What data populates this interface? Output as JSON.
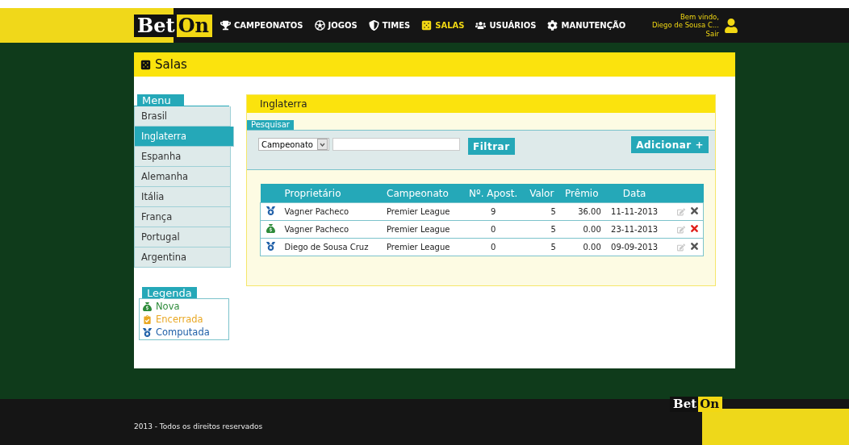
{
  "header": {
    "logo": {
      "part_1": "Bet",
      "part_2": "On"
    },
    "nav": [
      {
        "label": "CAMPEONATOS",
        "kind": "trophy",
        "selected": false
      },
      {
        "label": "JOGOS",
        "kind": "ball",
        "selected": false
      },
      {
        "label": "TIMES",
        "kind": "shield",
        "selected": false
      },
      {
        "label": "SALAS",
        "kind": "dice",
        "selected": true
      },
      {
        "label": "USUÁRIOS",
        "kind": "users",
        "selected": false
      },
      {
        "label": "MANUTENÇÃO",
        "kind": "gear",
        "selected": false
      }
    ],
    "user": {
      "greeting": "Bem vindo,",
      "name": "Diego de Sousa C...",
      "logout": "Sair"
    }
  },
  "page_title": "Salas",
  "sidebar": {
    "menu_title": "Menu",
    "items": [
      {
        "label": "Brasil",
        "selected": false
      },
      {
        "label": "Inglaterra",
        "selected": true
      },
      {
        "label": "Espanha",
        "selected": false
      },
      {
        "label": "Alemanha",
        "selected": false
      },
      {
        "label": "Itália",
        "selected": false
      },
      {
        "label": "França",
        "selected": false
      },
      {
        "label": "Portugal",
        "selected": false
      },
      {
        "label": "Argentina",
        "selected": false
      }
    ],
    "legend_title": "Legenda",
    "legend": [
      {
        "label": "Nova",
        "kind": "nova",
        "color": "#2e8b3a"
      },
      {
        "label": "Encerrada",
        "kind": "encerrada",
        "color": "#e9a825"
      },
      {
        "label": "Computada",
        "kind": "computada",
        "color": "#1f5fa8"
      }
    ]
  },
  "panel": {
    "title": "Inglaterra",
    "search": {
      "legend": "Pesquisar",
      "select_value": "Campeonato",
      "filter_button": "Filtrar",
      "add_button": "Adicionar +"
    },
    "table": {
      "columns": [
        "Proprietário",
        "Campeonato",
        "Nº. Apost.",
        "Valor",
        "Prêmio",
        "Data"
      ],
      "rows": [
        {
          "kind": "computada",
          "owner": "Vagner Pacheco",
          "championship": "Premier League",
          "bets": "9",
          "value": "5",
          "prize": "36.00",
          "date": "11-11-2013",
          "deletable": false
        },
        {
          "kind": "nova",
          "owner": "Vagner Pacheco",
          "championship": "Premier League",
          "bets": "0",
          "value": "5",
          "prize": "0.00",
          "date": "23-11-2013",
          "deletable": true
        },
        {
          "kind": "computada",
          "owner": "Diego de Sousa Cruz",
          "championship": "Premier League",
          "bets": "0",
          "value": "5",
          "prize": "0.00",
          "date": "09-09-2013",
          "deletable": false
        }
      ]
    }
  },
  "footer": {
    "copyright": "2013 - Todos os direitos reservados",
    "logo": {
      "part_1": "Bet",
      "part_2": "On"
    }
  }
}
